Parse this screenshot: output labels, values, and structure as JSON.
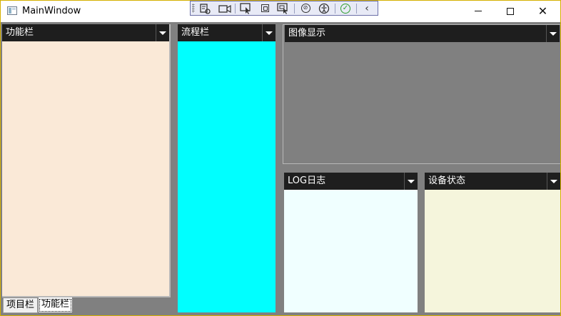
{
  "window": {
    "title": "MainWindow",
    "controls": {
      "minimize_icon": "minimize-icon",
      "maximize_icon": "maximize-icon",
      "close_icon": "close-icon"
    }
  },
  "debug_toolbar": {
    "buttons": [
      "live-visual-tree-icon",
      "camera-icon",
      "select-element-icon",
      "display-layout-adorners-icon",
      "track-focused-element-icon",
      "binding-failures-icon",
      "accessibility-icon",
      "hot-reload-ok-icon",
      "collapse-toolbar-icon"
    ]
  },
  "panes": {
    "function_panel": {
      "title": "功能栏",
      "bg": "#fae9d7"
    },
    "flow_panel": {
      "title": "流程栏",
      "bg": "#00ffff"
    },
    "image_display": {
      "title": "图像显示",
      "bg": "#808080"
    },
    "log_panel": {
      "title": "LOG日志",
      "bg": "#f0ffff"
    },
    "device_status": {
      "title": "设备状态",
      "bg": "#f5f5dc"
    }
  },
  "bottom_tabs": [
    {
      "label": "项目栏",
      "selected": false
    },
    {
      "label": "功能栏",
      "selected": true
    }
  ],
  "colors": {
    "header_bg": "#1e1e1e",
    "client_bg": "#808080",
    "frame_border": "#d4b000",
    "toolbar_bg": "#e8eaf6"
  }
}
